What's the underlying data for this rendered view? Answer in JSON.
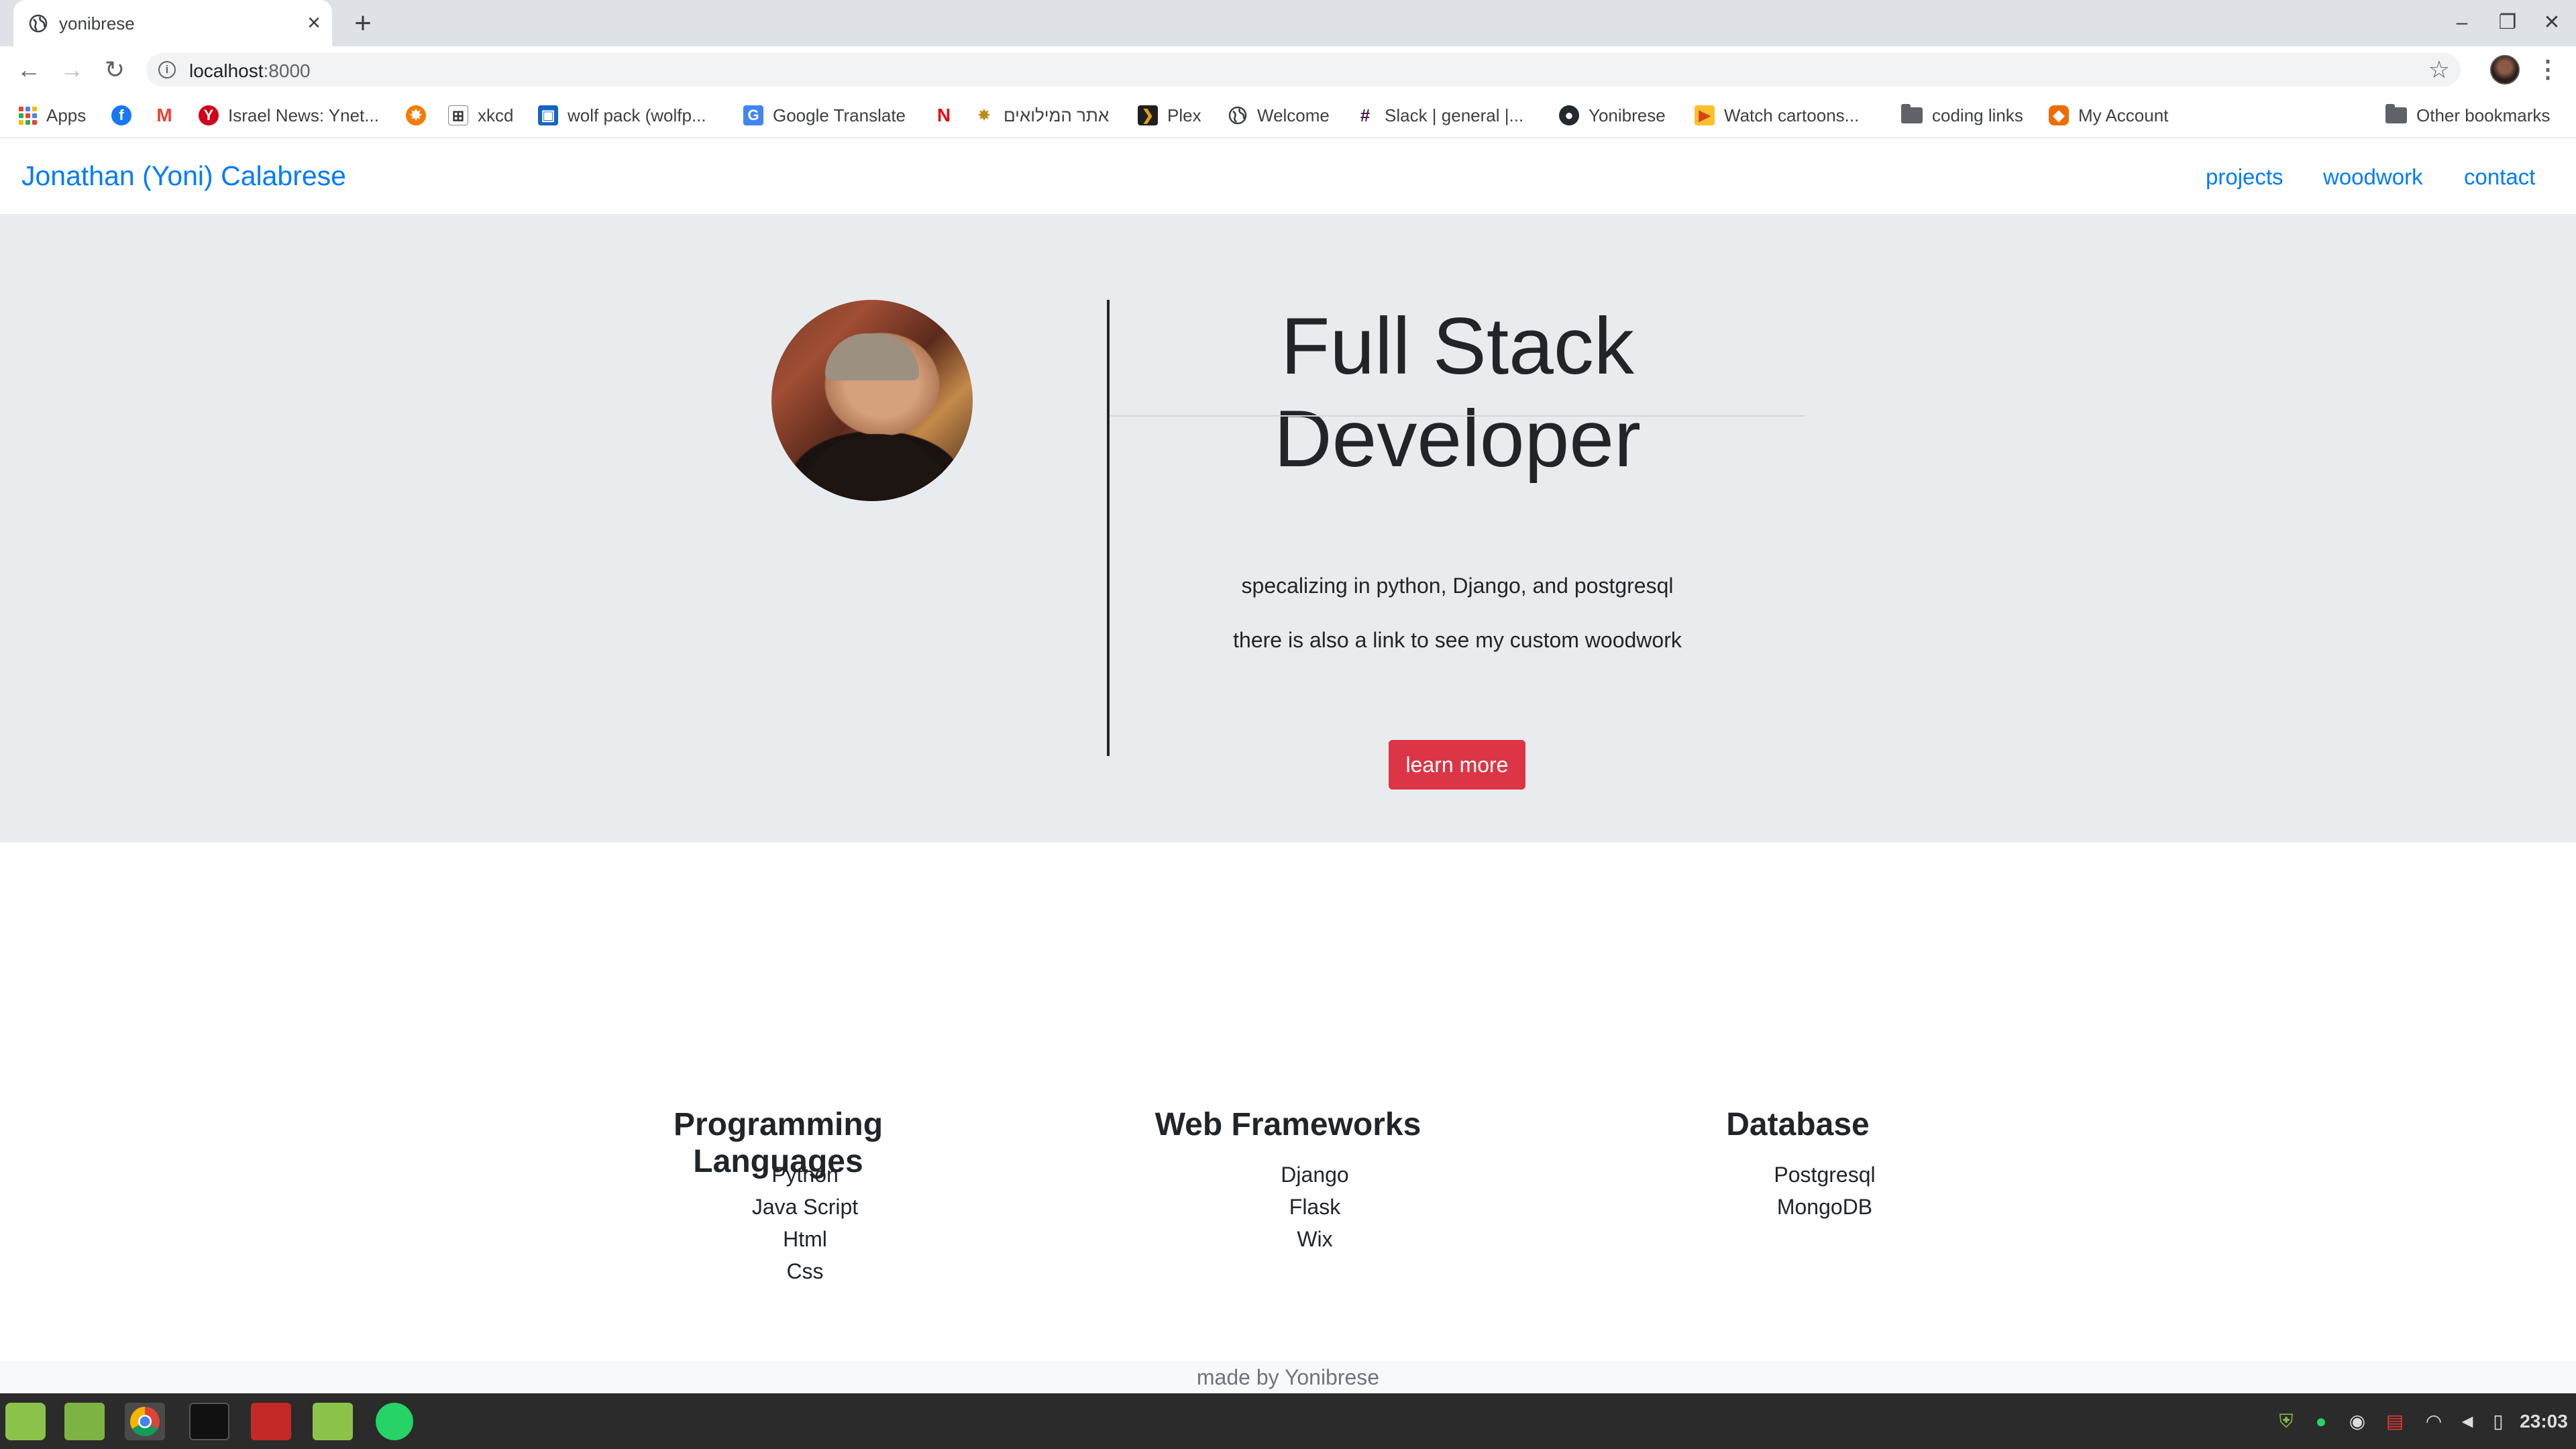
{
  "browser": {
    "tab_title": "yonibrese",
    "new_tab": "+",
    "url_host": "localhost",
    "url_port": ":8000",
    "bookmarks": [
      {
        "label": "Apps"
      },
      {
        "label": ""
      },
      {
        "label": ""
      },
      {
        "label": "Israel News: Ynet..."
      },
      {
        "label": ""
      },
      {
        "label": "xkcd"
      },
      {
        "label": "wolf pack (wolfp..."
      },
      {
        "label": "Google Translate"
      },
      {
        "label": ""
      },
      {
        "label": "אתר המילואים"
      },
      {
        "label": "Plex"
      },
      {
        "label": "Welcome"
      },
      {
        "label": "Slack | general |..."
      },
      {
        "label": "Yonibrese"
      },
      {
        "label": "Watch cartoons..."
      },
      {
        "label": "coding links"
      },
      {
        "label": "My Account"
      },
      {
        "label": "Other bookmarks"
      }
    ]
  },
  "site": {
    "brand": "Jonathan (Yoni) Calabrese",
    "nav": [
      "projects",
      "woodwork",
      "contact"
    ],
    "hero": {
      "heading": "Full Stack Developer",
      "lines": [
        "specalizing in python, Django, and postgresql",
        "there is also a link to see my custom woodwork"
      ],
      "button": "learn more"
    },
    "skills": [
      {
        "title": "Programming Languages",
        "items": [
          "Python",
          "Java Script",
          "Html",
          "Css"
        ]
      },
      {
        "title": "Web Frameworks",
        "items": [
          "Django",
          "Flask",
          "Wix"
        ]
      },
      {
        "title": "Database",
        "items": [
          "Postgresql",
          "MongoDB"
        ]
      }
    ],
    "footer": "made by Yonibrese"
  },
  "taskbar": {
    "clock": "23:03"
  },
  "colors": {
    "link": "#007bff",
    "button": "#dc3545",
    "jumbotron": "#e9ecef"
  }
}
